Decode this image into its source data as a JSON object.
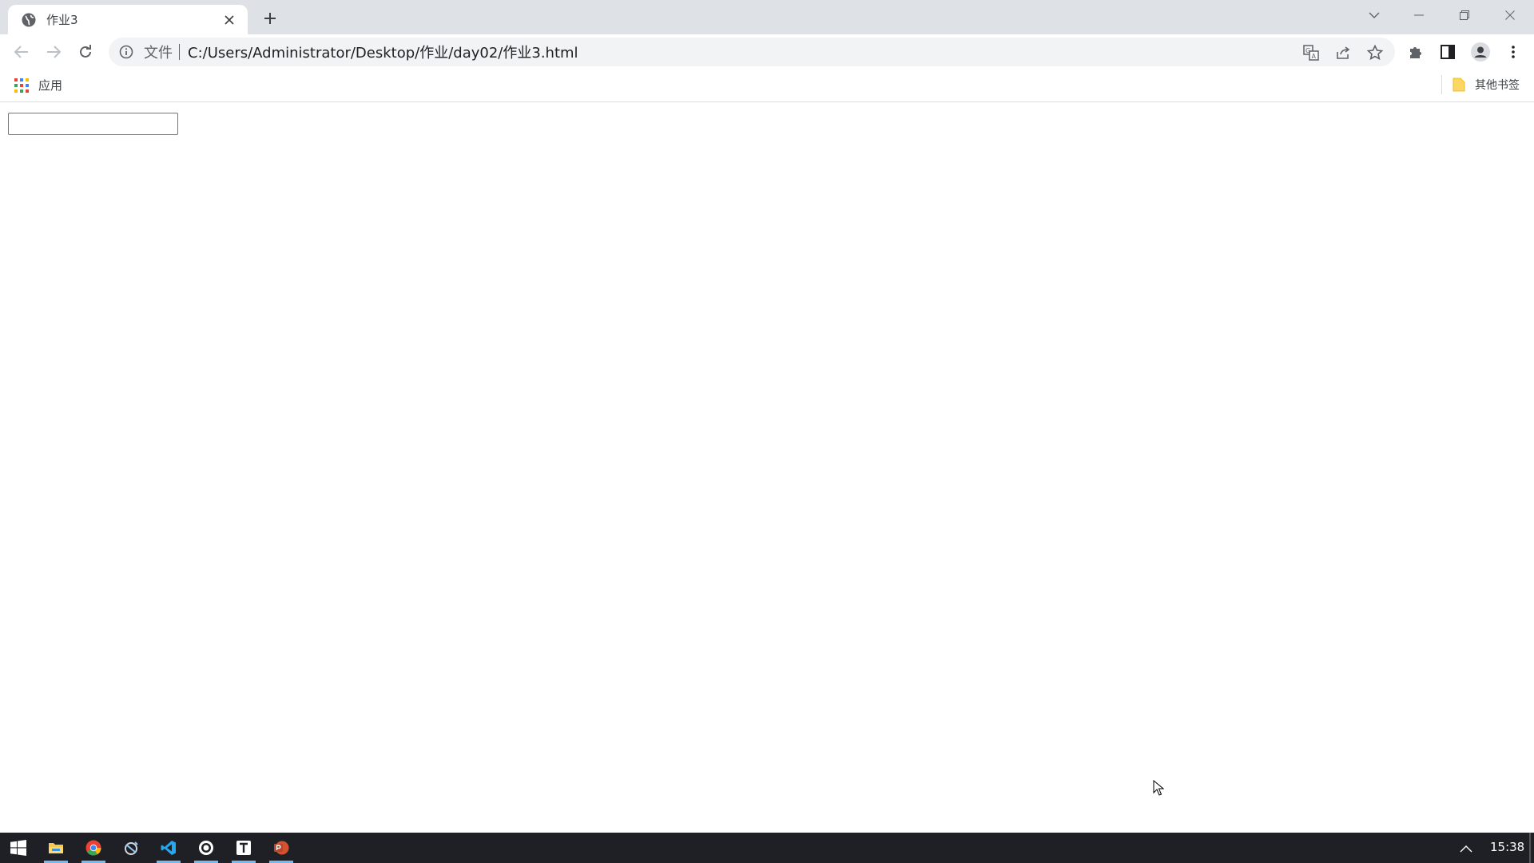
{
  "browser": {
    "tab": {
      "title": "作业3"
    },
    "omnibox": {
      "scheme_label": "文件",
      "url": "C:/Users/Administrator/Desktop/作业/day02/作业3.html"
    },
    "bookmarks": {
      "apps_label": "应用",
      "other_label": "其他书签"
    }
  },
  "page": {
    "text_input_value": ""
  },
  "taskbar": {
    "clock": "15:38",
    "apps": [
      "file-explorer",
      "chrome",
      "app-3",
      "vscode",
      "app-5",
      "typora",
      "powerpoint"
    ]
  },
  "colors": {
    "tabstrip_bg": "#dee1e6",
    "omnibox_bg": "#f1f3f4",
    "taskbar_bg": "#1f2026",
    "taskbar_active": "#76b9ed"
  }
}
